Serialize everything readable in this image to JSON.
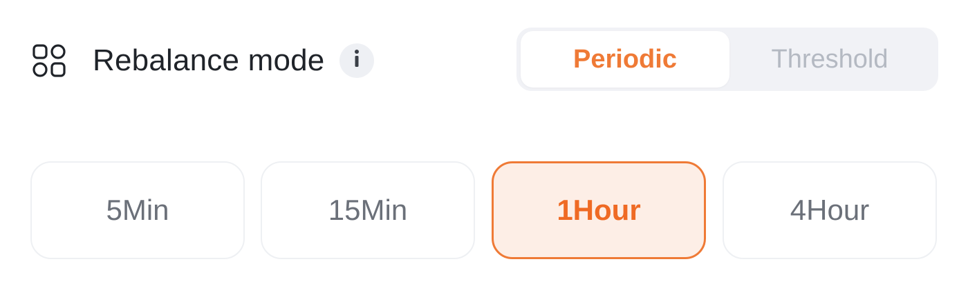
{
  "header": {
    "icon": "grid-apps-icon",
    "title": "Rebalance mode",
    "info_icon": "info-icon"
  },
  "mode_toggle": {
    "options": [
      "Periodic",
      "Threshold"
    ],
    "selected": "Periodic"
  },
  "intervals": {
    "options": [
      "5Min",
      "15Min",
      "1Hour",
      "4Hour"
    ],
    "selected": "1Hour"
  },
  "colors": {
    "accent": "#ef7a36",
    "accent_bg": "#fdeee6",
    "text_primary": "#1f2329",
    "text_muted": "#6b7079",
    "toggle_inactive": "#b4b9c2",
    "toggle_track": "#f1f2f6"
  }
}
